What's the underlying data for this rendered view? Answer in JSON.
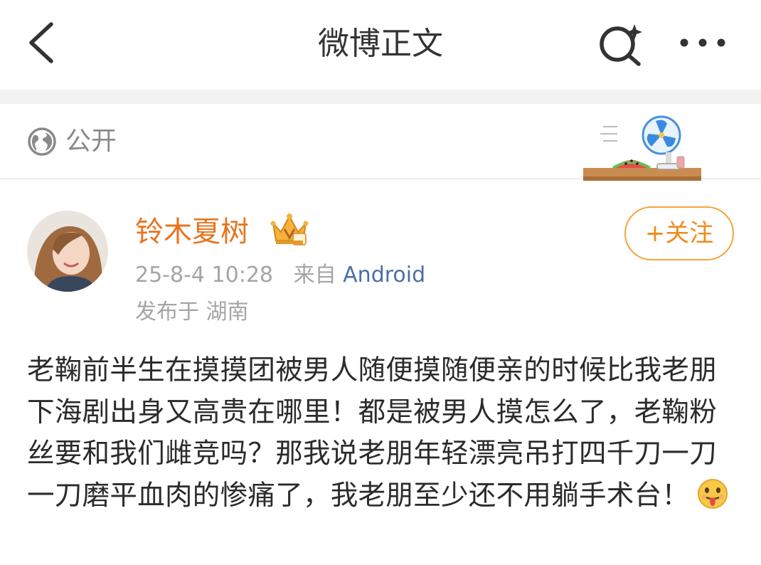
{
  "header": {
    "title": "微博正文",
    "back_icon": "back-arrow-icon",
    "search_icon": "search-sparkle-icon",
    "more_icon": "more-dots-icon"
  },
  "visibility": {
    "icon": "globe-icon",
    "label": "公开"
  },
  "post": {
    "author": {
      "name": "铃木夏树",
      "badge_icon": "vip-crown-icon"
    },
    "follow_label": "+关注",
    "timestamp": "25-8-4 10:28",
    "source_prefix": "来自",
    "source": "Android",
    "location": "发布于 湖南",
    "text": "老鞠前半生在摸摸团被男人随便摸随便亲的时候比我老朋下海剧出身又高贵在哪里！都是被男人摸怎么了，老鞠粉丝要和我们雌竞吗？那我说老朋年轻漂亮吊打四千刀一刀一刀磨平血肉的惨痛了，我老朋至少还不用躺手术台！",
    "emoji_icon": "tongue-out-emoji-icon"
  },
  "colors": {
    "accent_orange": "#e8741e",
    "link_blue": "#4a6ea8",
    "gray_text": "#a5a5a5"
  }
}
